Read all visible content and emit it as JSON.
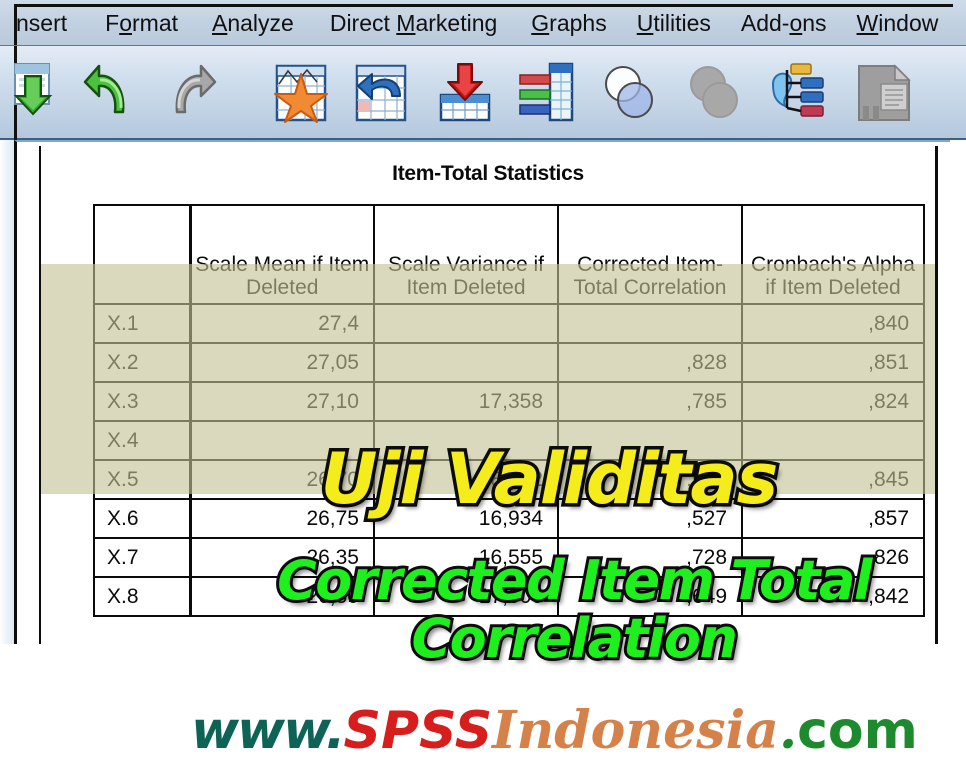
{
  "window": {
    "app": "SPSS Statistics Viewer"
  },
  "menubar": {
    "items": [
      {
        "label": "nsert",
        "accel": "",
        "truncated": true
      },
      {
        "label": "Format",
        "accel": "o"
      },
      {
        "label": "Analyze",
        "accel": "A"
      },
      {
        "label": "Direct Marketing",
        "accel": "M"
      },
      {
        "label": "Graphs",
        "accel": "G"
      },
      {
        "label": "Utilities",
        "accel": "U"
      },
      {
        "label": "Add-ons",
        "accel": "o"
      },
      {
        "label": "Window",
        "accel": "W"
      }
    ]
  },
  "toolbar": {
    "icons": [
      {
        "name": "save-green-down-arrow-icon",
        "title": "Save"
      },
      {
        "name": "undo-green-arrow-icon",
        "title": "Undo"
      },
      {
        "name": "redo-gray-arrow-icon",
        "title": "Redo"
      },
      {
        "name": "goto-case-star-chart-icon",
        "title": "Go to case"
      },
      {
        "name": "goto-variable-grid-icon",
        "title": "Go to variable"
      },
      {
        "name": "insert-cases-red-arrow-icon",
        "title": "Insert cases"
      },
      {
        "name": "split-file-bars-grid-icon",
        "title": "Split file"
      },
      {
        "name": "venn-circles-outline-icon",
        "title": "Select cases"
      },
      {
        "name": "venn-circles-filled-icon",
        "title": "Weight cases"
      },
      {
        "name": "value-labels-map-icon",
        "title": "Value labels"
      },
      {
        "name": "use-sets-document-icon",
        "title": "Use sets"
      }
    ]
  },
  "output": {
    "table": {
      "title": "Item-Total Statistics",
      "corner_header": "",
      "headers": [
        "Scale Mean if Item Deleted",
        "Scale Variance if Item Deleted",
        "Corrected Item-Total Correlation",
        "Cronbach's Alpha if Item Deleted"
      ],
      "rows": [
        {
          "label": "X.1",
          "values": [
            "27,4",
            "",
            "",
            ",840"
          ]
        },
        {
          "label": "X.2",
          "values": [
            "27,05",
            "",
            ",828",
            ",851"
          ]
        },
        {
          "label": "X.3",
          "values": [
            "27,10",
            "17,358",
            ",785",
            ",824"
          ]
        },
        {
          "label": "X.4",
          "values": [
            "",
            "",
            "",
            ""
          ]
        },
        {
          "label": "X.5",
          "values": [
            "26,70",
            "18,642",
            ",587",
            ",845"
          ]
        },
        {
          "label": "X.6",
          "values": [
            "26,75",
            "16,934",
            ",527",
            ",857"
          ]
        },
        {
          "label": "X.7",
          "values": [
            "26,35",
            "16,555",
            ",728",
            ",826"
          ]
        },
        {
          "label": "X.8",
          "values": [
            "26,50",
            "17,000",
            ",649",
            ",842"
          ]
        }
      ]
    }
  },
  "watermarks": {
    "title_yellow": "Uji Validitas",
    "subtitle_green": "Corrected Item Total Correlation",
    "url": {
      "www": "www.",
      "spss": "SPSS",
      "indonesia": "Indonesia",
      "dot": ".",
      "com": "com"
    }
  },
  "colors": {
    "yellow_text": "#f5ec1b",
    "green_text": "#1ef01e",
    "outline": "#0d0d0d",
    "toolbar_bg": "#c2d3e5",
    "menubar_bg": "#c3d2e2",
    "tint_band": "#c4c196",
    "url_www": "#0d6355",
    "url_spss": "#d81d1d",
    "url_indonesia": "#d4824a",
    "url_com": "#1e8a2e"
  }
}
